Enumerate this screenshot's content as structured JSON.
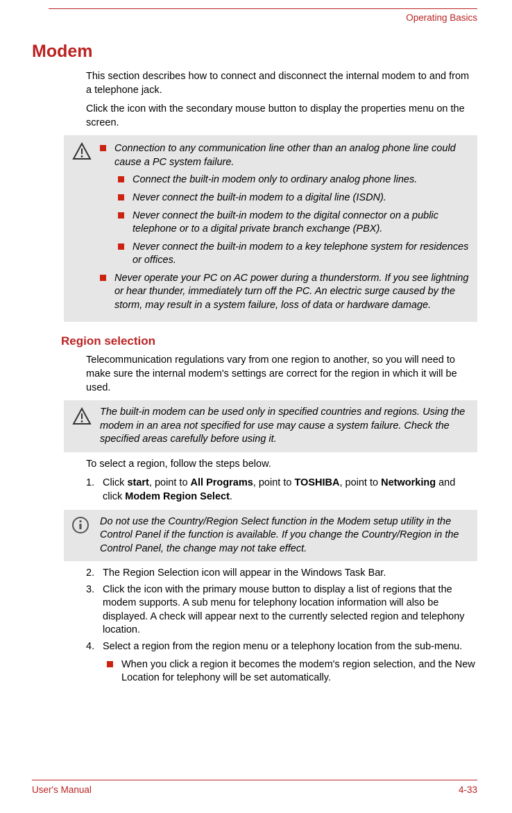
{
  "header": {
    "right": "Operating Basics"
  },
  "h1": "Modem",
  "intro1": "This section describes how to connect and disconnect the internal modem to and from a telephone jack.",
  "intro2": "Click the icon with the secondary mouse button to display the properties menu on the screen.",
  "caution1": {
    "b1": "Connection to any communication line other than an analog phone line could cause a PC system failure.",
    "s1": "Connect the built-in modem only to ordinary analog phone lines.",
    "s2": "Never connect the built-in modem to a digital line (ISDN).",
    "s3": "Never connect the built-in modem to the digital connector on a public telephone or to a digital private branch exchange (PBX).",
    "s4": "Never connect the built-in modem to a key telephone system for residences or offices.",
    "b2": "Never operate your PC on AC power during a thunderstorm. If you see lightning or hear thunder, immediately turn off the PC. An electric surge caused by the storm, may result in a system failure, loss of data or hardware damage."
  },
  "h2": "Region selection",
  "region_p": "Telecommunication regulations vary from one region to another, so you will need to make sure the internal modem's settings are correct for the region in which it will be used.",
  "caution2": "The built-in modem can be used only in specified countries and regions. Using the modem in an area not specified for use may cause a system failure. Check the specified areas carefully before using it.",
  "region_intro": "To select a region, follow the steps below.",
  "step1": {
    "num": "1.",
    "pre": "Click ",
    "b1": "start",
    "t1": ", point to ",
    "b2": "All Programs",
    "t2": ", point to ",
    "b3": "TOSHIBA",
    "t3": ", point to ",
    "b4": "Networking",
    "t4": " and click ",
    "b5": "Modem Region Select",
    "t5": "."
  },
  "note1": "Do not use the Country/Region Select function in the Modem setup utility in the Control Panel if the function is available. If you change the Country/Region in the Control Panel, the change may not take effect.",
  "step2": {
    "num": "2.",
    "txt": "The Region Selection icon will appear in the Windows Task Bar."
  },
  "step3": {
    "num": "3.",
    "txt": "Click the icon with the primary mouse button to display a list of regions that the modem supports. A sub menu for telephony location information will also be displayed. A check will appear next to the currently selected region and telephony location."
  },
  "step4": {
    "num": "4.",
    "txt": "Select a region from the region menu or a telephony location from the sub-menu."
  },
  "sub1": "When you click a region it becomes the modem's region selection, and the New Location for telephony will be set automatically.",
  "footer": {
    "left": "User's Manual",
    "right": "4-33"
  }
}
